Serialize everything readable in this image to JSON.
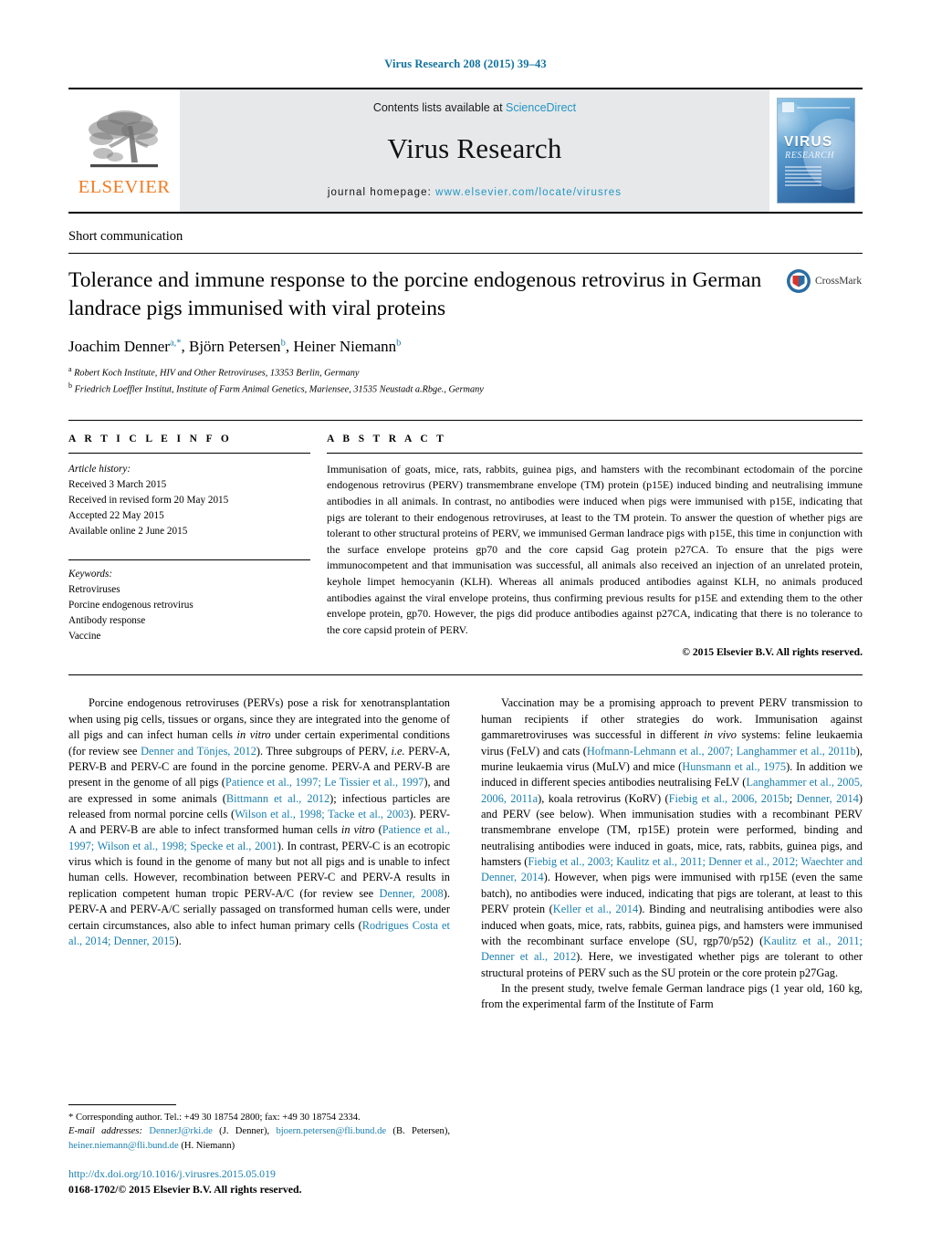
{
  "running_head": "Virus Research 208 (2015) 39–43",
  "masthead": {
    "publisher_name": "ELSEVIER",
    "contents_prefix": "Contents lists available at ",
    "contents_link": "ScienceDirect",
    "journal_name": "Virus Research",
    "homepage_prefix": "journal homepage: ",
    "homepage_url": "www.elsevier.com/locate/virusres",
    "cover_title": "VIRUS",
    "cover_subtitle": "RESEARCH"
  },
  "article": {
    "type_label": "Short communication",
    "title": "Tolerance and immune response to the porcine endogenous retrovirus in German landrace pigs immunised with viral proteins",
    "authors": [
      {
        "name": "Joachim Denner",
        "marks": "a,*"
      },
      {
        "name": "Björn Petersen",
        "marks": "b"
      },
      {
        "name": "Heiner Niemann",
        "marks": "b"
      }
    ],
    "authors_line": "Joachim Denner",
    "affiliations": [
      {
        "mark": "a",
        "text": "Robert Koch Institute, HIV and Other Retroviruses, 13353 Berlin, Germany"
      },
      {
        "mark": "b",
        "text": "Friedrich Loeffler Institut, Institute of Farm Animal Genetics, Mariensee, 31535 Neustadt a.Rbge., Germany"
      }
    ],
    "crossmark_label": "CrossMark"
  },
  "article_info": {
    "heading": "A R T I C L E   I N F O",
    "history_label": "Article history:",
    "history": [
      "Received 3 March 2015",
      "Received in revised form 20 May 2015",
      "Accepted 22 May 2015",
      "Available online 2 June 2015"
    ],
    "keywords_label": "Keywords:",
    "keywords": [
      "Retroviruses",
      "Porcine endogenous retrovirus",
      "Antibody response",
      "Vaccine"
    ]
  },
  "abstract": {
    "heading": "A B S T R A C T",
    "text": "Immunisation of goats, mice, rats, rabbits, guinea pigs, and hamsters with the recombinant ectodomain of the porcine endogenous retrovirus (PERV) transmembrane envelope (TM) protein (p15E) induced binding and neutralising immune antibodies in all animals. In contrast, no antibodies were induced when pigs were immunised with p15E, indicating that pigs are tolerant to their endogenous retroviruses, at least to the TM protein. To answer the question of whether pigs are tolerant to other structural proteins of PERV, we immunised German landrace pigs with p15E, this time in conjunction with the surface envelope proteins gp70 and the core capsid Gag protein p27CA. To ensure that the pigs were immunocompetent and that immunisation was successful, all animals also received an injection of an unrelated protein, keyhole limpet hemocyanin (KLH). Whereas all animals produced antibodies against KLH, no animals produced antibodies against the viral envelope proteins, thus confirming previous results for p15E and extending them to the other envelope protein, gp70. However, the pigs did produce antibodies against p27CA, indicating that there is no tolerance to the core capsid protein of PERV.",
    "copyright": "© 2015 Elsevier B.V. All rights reserved."
  },
  "body": {
    "left_paragraph_1": "Porcine endogenous retroviruses (PERVs) pose a risk for xenotransplantation when using pig cells, tissues or organs, since they are integrated into the genome of all pigs and can infect human cells in vitro under certain experimental conditions (for review see Denner and Tönjes, 2012). Three subgroups of PERV, i.e. PERV-A, PERV-B and PERV-C are found in the porcine genome. PERV-A and PERV-B are present in the genome of all pigs (Patience et al., 1997; Le Tissier et al., 1997), and are expressed in some animals (Bittmann et al., 2012); infectious particles are released from normal porcine cells (Wilson et al., 1998; Tacke et al., 2003). PERV-A and PERV-B are able to infect transformed human cells in vitro (Patience et al., 1997; Wilson et al., 1998; Specke et al., 2001). In contrast, PERV-C is an ecotropic virus which is found in the genome of many but not all pigs and is unable to infect human cells. However, recombination between PERV-C and PERV-A results in replication competent human tropic PERV-A/C (for review see Denner, 2008). PERV-A and PERV-A/C serially passaged on transformed human cells were, under certain circumstances, also able to infect human primary cells (Rodrigues Costa et al., 2014; Denner, 2015).",
    "right_paragraph_1": "Vaccination may be a promising approach to prevent PERV transmission to human recipients if other strategies do work. Immunisation against gammaretroviruses was successful in different in vivo systems: feline leukaemia virus (FeLV) and cats (Hofmann-Lehmann et al., 2007; Langhammer et al., 2011b), murine leukaemia virus (MuLV) and mice (Hunsmann et al., 1975). In addition we induced in different species antibodies neutralising FeLV (Langhammer et al., 2005, 2006, 2011a), koala retrovirus (KoRV) (Fiebig et al., 2006, 2015b; Denner, 2014) and PERV (see below). When immunisation studies with a recombinant PERV transmembrane envelope (TM, rp15E) protein were performed, binding and neutralising antibodies were induced in goats, mice, rats, rabbits, guinea pigs, and hamsters (Fiebig et al., 2003; Kaulitz et al., 2011; Denner et al., 2012; Waechter and Denner, 2014). However, when pigs were immunised with rp15E (even the same batch), no antibodies were induced, indicating that pigs are tolerant, at least to this PERV protein (Keller et al., 2014). Binding and neutralising antibodies were also induced when goats, mice, rats, rabbits, guinea pigs, and hamsters were immunised with the recombinant surface envelope (SU, rgp70/p52) (Kaulitz et al., 2011; Denner et al., 2012). Here, we investigated whether pigs are tolerant to other structural proteins of PERV such as the SU protein or the core protein p27Gag.",
    "right_paragraph_2": "In the present study, twelve female German landrace pigs (1 year old, 160 kg, from the experimental farm of the Institute of Farm"
  },
  "footnotes": {
    "corresponding": "* Corresponding author. Tel.: +49 30 18754 2800; fax: +49 30 18754 2334.",
    "email_label": "E-mail addresses:",
    "emails": [
      {
        "address": "DennerJ@rki.de",
        "owner": "(J. Denner)"
      },
      {
        "address": "bjoern.petersen@fli.bund.de",
        "owner": "(B. Petersen)"
      },
      {
        "address": "heiner.niemann@fli.bund.de",
        "owner": "(H. Niemann)"
      }
    ]
  },
  "bottom": {
    "doi": "http://dx.doi.org/10.1016/j.virusres.2015.05.019",
    "issn_line": "0168-1702/© 2015 Elsevier B.V. All rights reserved."
  },
  "colors": {
    "link_blue": "#1a7fae",
    "elsevier_orange": "#f47b20",
    "masthead_grey": "#e7e8ea"
  }
}
